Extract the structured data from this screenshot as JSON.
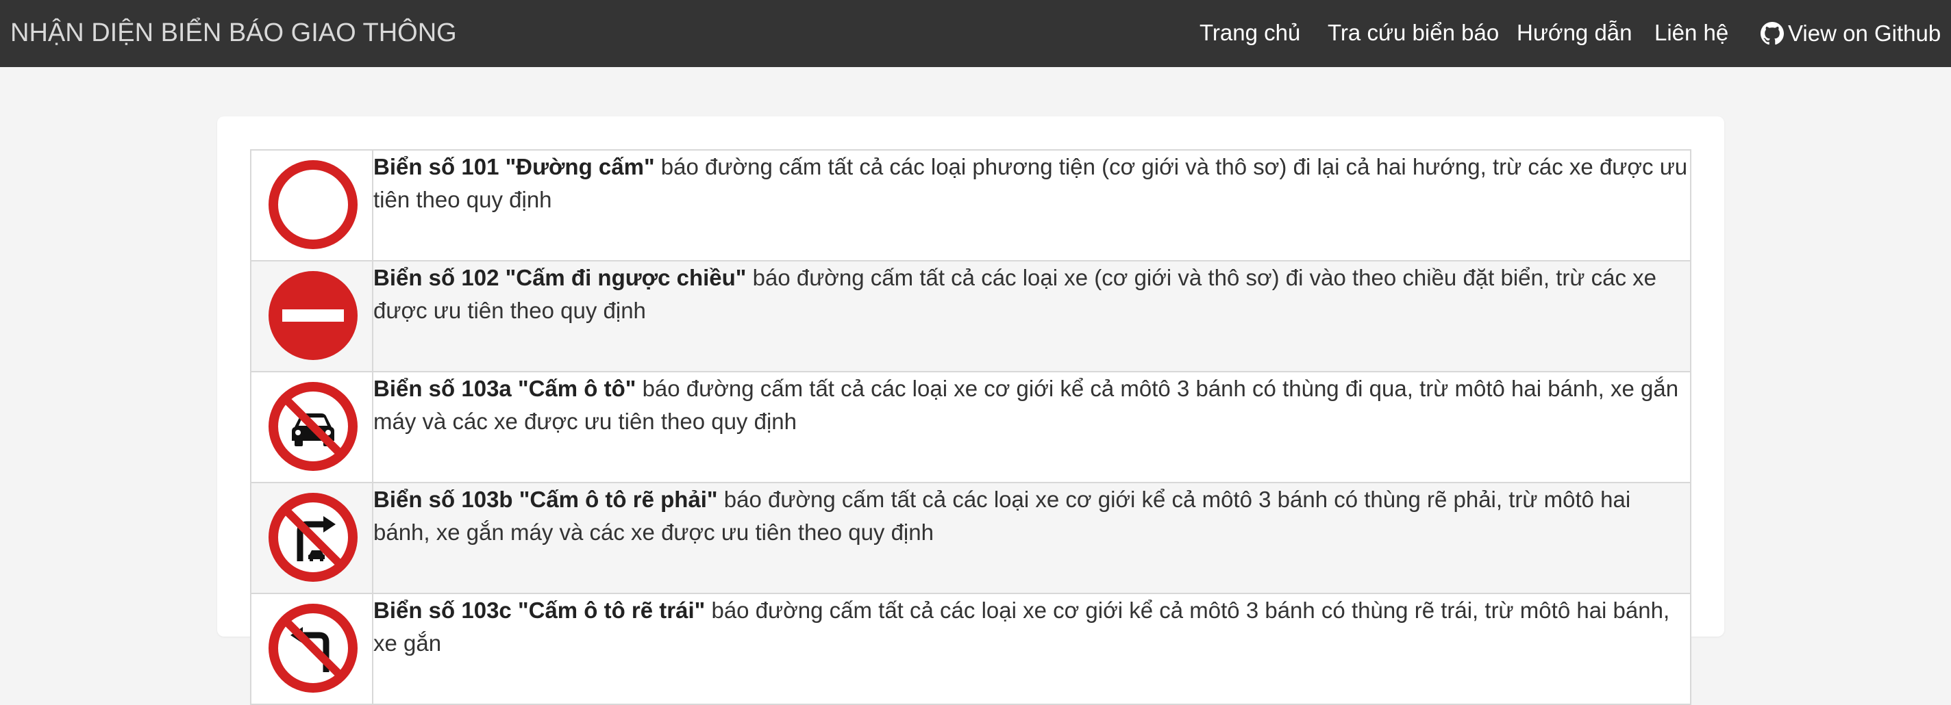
{
  "navbar": {
    "brand": "NHẬN DIỆN BIỂN BÁO GIAO THÔNG",
    "links": [
      {
        "label": "Trang chủ"
      },
      {
        "label": "Tra cứu biển báo"
      },
      {
        "label": "Hướng dẫn"
      },
      {
        "label": "Liên hệ"
      }
    ],
    "github_label": "View on Github"
  },
  "signs": [
    {
      "icon": "no-entry-both-ways-sign",
      "title": "Biển số 101 \"Đường cấm\"",
      "description": " báo đường cấm tất cả các loại phương tiện (cơ giới và thô sơ) đi lại cả hai hướng, trừ các xe được ưu tiên theo quy định"
    },
    {
      "icon": "no-entry-sign",
      "title": "Biển số 102 \"Cấm đi ngược chiều\"",
      "description": " báo đường cấm tất cả các loại xe (cơ giới và thô sơ) đi vào theo chiều đặt biển, trừ các xe được ưu tiên theo quy định"
    },
    {
      "icon": "no-cars-sign",
      "title": "Biển số 103a \"Cấm ô tô\"",
      "description": " báo đường cấm tất cả các loại xe cơ giới kể cả môtô 3 bánh có thùng đi qua, trừ môtô hai bánh, xe gắn máy và các xe được ưu tiên theo quy định"
    },
    {
      "icon": "no-cars-right-turn-sign",
      "title": "Biển số 103b \"Cấm ô tô rẽ phải\"",
      "description": " báo đường cấm tất cả các loại xe cơ giới kể cả môtô 3 bánh có thùng rẽ phải, trừ môtô hai bánh, xe gắn máy và các xe được ưu tiên theo quy định"
    },
    {
      "icon": "no-cars-left-turn-sign",
      "title": "Biển số 103c \"Cấm ô tô rẽ trái\"",
      "description": " báo đường cấm tất cả các loại xe cơ giới kể cả môtô 3 bánh có thùng rẽ trái, trừ môtô hai bánh, xe gắn"
    }
  ],
  "colors": {
    "navbar_bg": "#343434",
    "page_bg": "#f4f4f4",
    "sign_red": "#d42121"
  }
}
